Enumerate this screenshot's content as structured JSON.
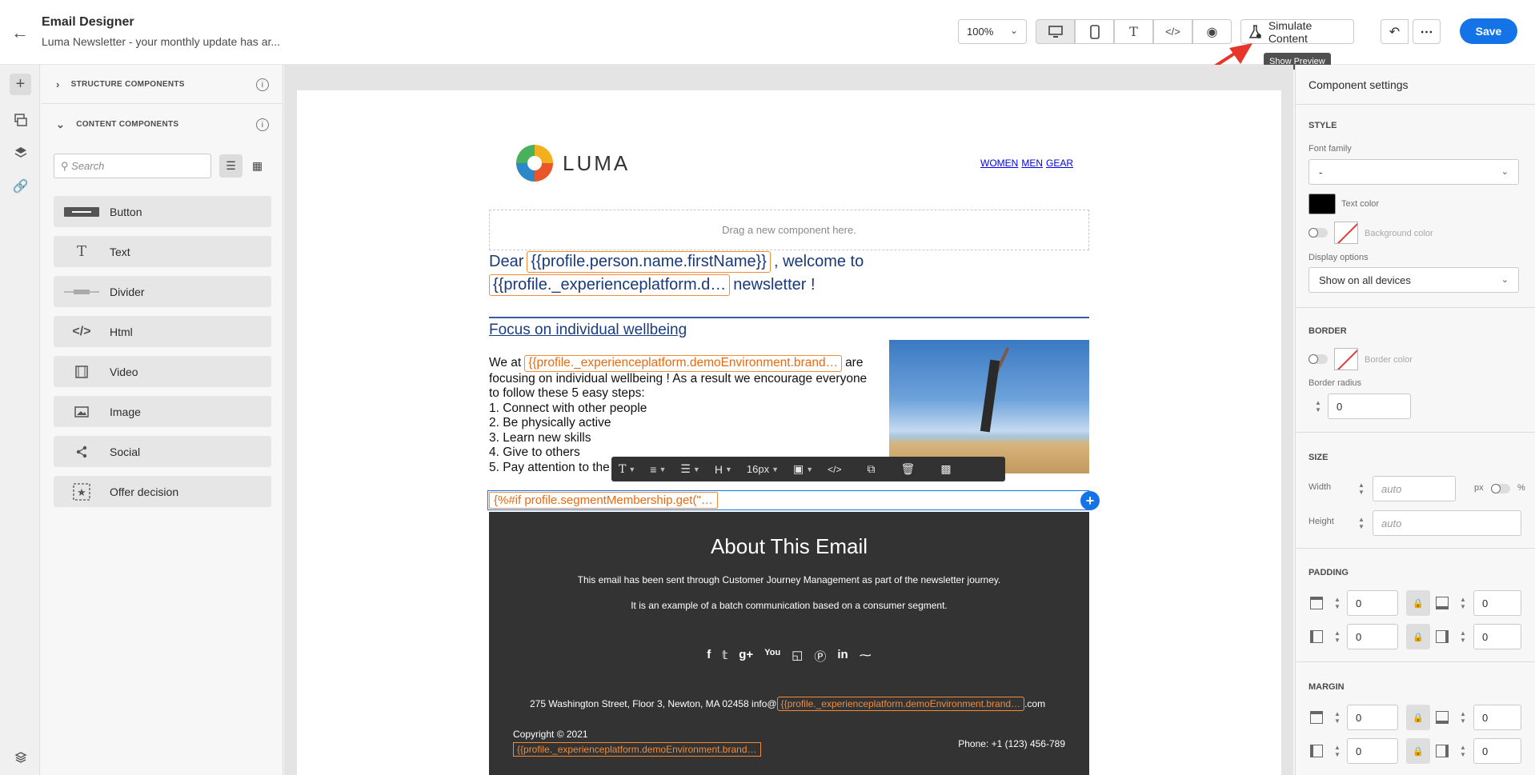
{
  "header": {
    "title": "Email Designer",
    "subtitle": "Luma Newsletter - your monthly update has ar...",
    "zoom": "100%",
    "simulate_label": "Simulate Content",
    "save_label": "Save",
    "tooltip": "Show Preview"
  },
  "components_panel": {
    "structure_label": "STRUCTURE COMPONENTS",
    "content_label": "CONTENT COMPONENTS",
    "search_placeholder": "Search",
    "items": [
      {
        "label": "Button",
        "icon": "button-icon"
      },
      {
        "label": "Text",
        "icon": "text-icon"
      },
      {
        "label": "Divider",
        "icon": "divider-icon"
      },
      {
        "label": "Html",
        "icon": "html-icon"
      },
      {
        "label": "Video",
        "icon": "video-icon"
      },
      {
        "label": "Image",
        "icon": "image-icon"
      },
      {
        "label": "Social",
        "icon": "social-icon"
      },
      {
        "label": "Offer decision",
        "icon": "offer-decision-icon"
      }
    ]
  },
  "email": {
    "logo_text": "LUMA",
    "nav_links": [
      "WOMEN",
      "MEN",
      "GEAR"
    ],
    "drop_zone": "Drag a new component here.",
    "greeting_prefix": "Dear",
    "greeting_token": "{{profile.person.name.firstName}}",
    "greeting_middle": ", welcome to",
    "greeting_token2": "{{profile._experienceplatform.d…",
    "greeting_suffix": "newsletter !",
    "focus_title": "Focus on individual wellbeing ",
    "body_we_at": "We at",
    "body_token": "{{profile._experienceplatform.demoEnvironment.brand…",
    "body_are": "are",
    "body_lines": [
      "focusing on individual wellbeing ! As a result we encourage everyone",
      "to follow these 5 easy steps:",
      "1. Connect with other people",
      "2. Be physically active",
      "3. Learn new skills",
      "4. Give to others",
      "5. Pay attention to the"
    ],
    "toolbar_font_size": "16px",
    "toolbar_heading": "H",
    "cond_token": "{%#if profile.segmentMembership.get(\"…",
    "footer": {
      "title": "About This Email",
      "line1": "This email has been sent through Customer Journey Management as part of the newsletter journey.",
      "line2": "It is an example of a batch communication based on a consumer segment.",
      "address": "275 Washington Street, Floor 3, Newton, MA 02458 info@",
      "address_token": "{{profile._experienceplatform.demoEnvironment.brand…",
      "address_suffix": ".com",
      "copyright": "Copyright © 2021",
      "copyright_token": "{{profile._experienceplatform.demoEnvironment.brand…",
      "phone": "Phone: +1 (123) 456-789"
    }
  },
  "settings": {
    "title": "Component settings",
    "style_head": "STYLE",
    "font_family_label": "Font family",
    "font_family_value": "-",
    "text_color_label": "Text color",
    "text_color": "#000000",
    "bg_color_label": "Background color",
    "display_options_label": "Display options",
    "display_options_value": "Show on all devices",
    "border_head": "BORDER",
    "border_color_label": "Border color",
    "border_radius_label": "Border radius",
    "border_radius_value": "0",
    "size_head": "SIZE",
    "width_label": "Width",
    "height_label": "Height",
    "auto": "auto",
    "px": "px",
    "pct": "%",
    "padding_head": "PADDING",
    "margin_head": "MARGIN",
    "zero": "0"
  }
}
